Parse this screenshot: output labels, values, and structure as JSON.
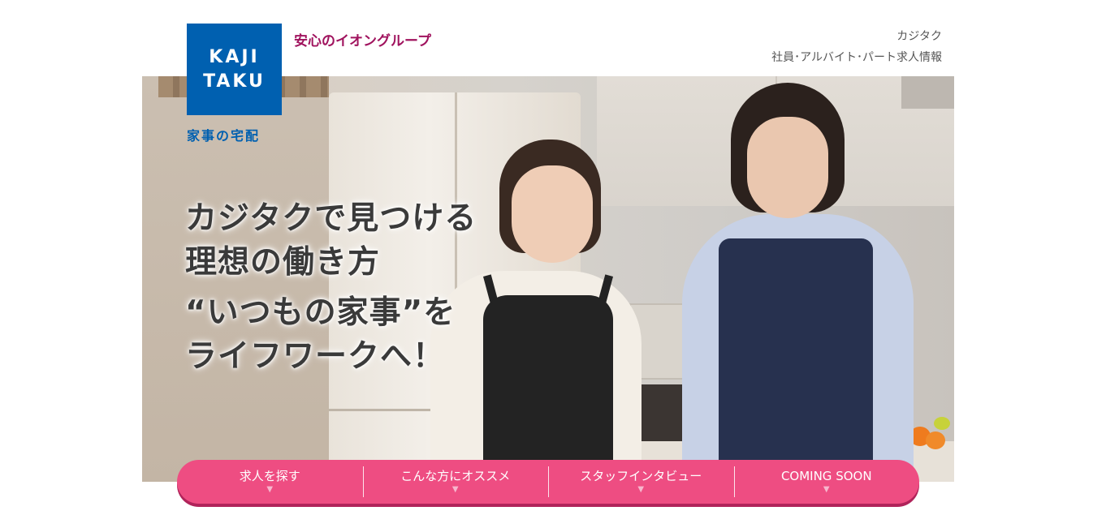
{
  "logo": {
    "line1": "KAJI",
    "line2": "TAKU",
    "subtitle": "家事の宅配",
    "color": "#0060b0"
  },
  "group_tag": "安心のイオングループ",
  "header_links": {
    "brand": "カジタク",
    "recruit": "社員･アルバイト･パート求人情報"
  },
  "hero": {
    "line1": "カジタクで見つける",
    "line2": "理想の働き方",
    "line3": "“いつもの家事”を",
    "line4": "ライフワークへ！"
  },
  "nav": {
    "color": "#ee4d82",
    "items": [
      {
        "label": "求人を探す",
        "caret": "▼"
      },
      {
        "label": "こんな方にオススメ",
        "caret": "▼"
      },
      {
        "label": "スタッフインタビュー",
        "caret": "▼"
      },
      {
        "label": "COMING SOON",
        "caret": "▼"
      }
    ]
  }
}
